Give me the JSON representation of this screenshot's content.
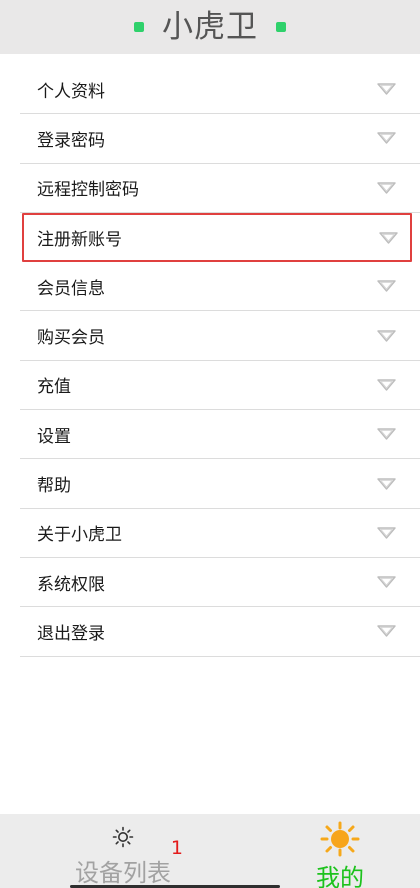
{
  "app": {
    "title": "小虎卫",
    "accent": "#2fd16b"
  },
  "menu": {
    "items": [
      {
        "label": "个人资料"
      },
      {
        "label": "登录密码"
      },
      {
        "label": "远程控制密码"
      },
      {
        "label": "注册新账号"
      },
      {
        "label": "会员信息"
      },
      {
        "label": "购买会员"
      },
      {
        "label": "充值"
      },
      {
        "label": "设置"
      },
      {
        "label": "帮助"
      },
      {
        "label": "关于小虎卫"
      },
      {
        "label": "系统权限"
      },
      {
        "label": "退出登录"
      }
    ],
    "highlight_color": "#e0403f",
    "chevron_icon": "chevron-down-icon"
  },
  "tabbar": {
    "devices": {
      "label": "设备列表",
      "badge": "1",
      "icon": "gear-icon"
    },
    "mine": {
      "label": "我的",
      "icon": "sun-icon",
      "active_color": "#1cc21c"
    }
  }
}
